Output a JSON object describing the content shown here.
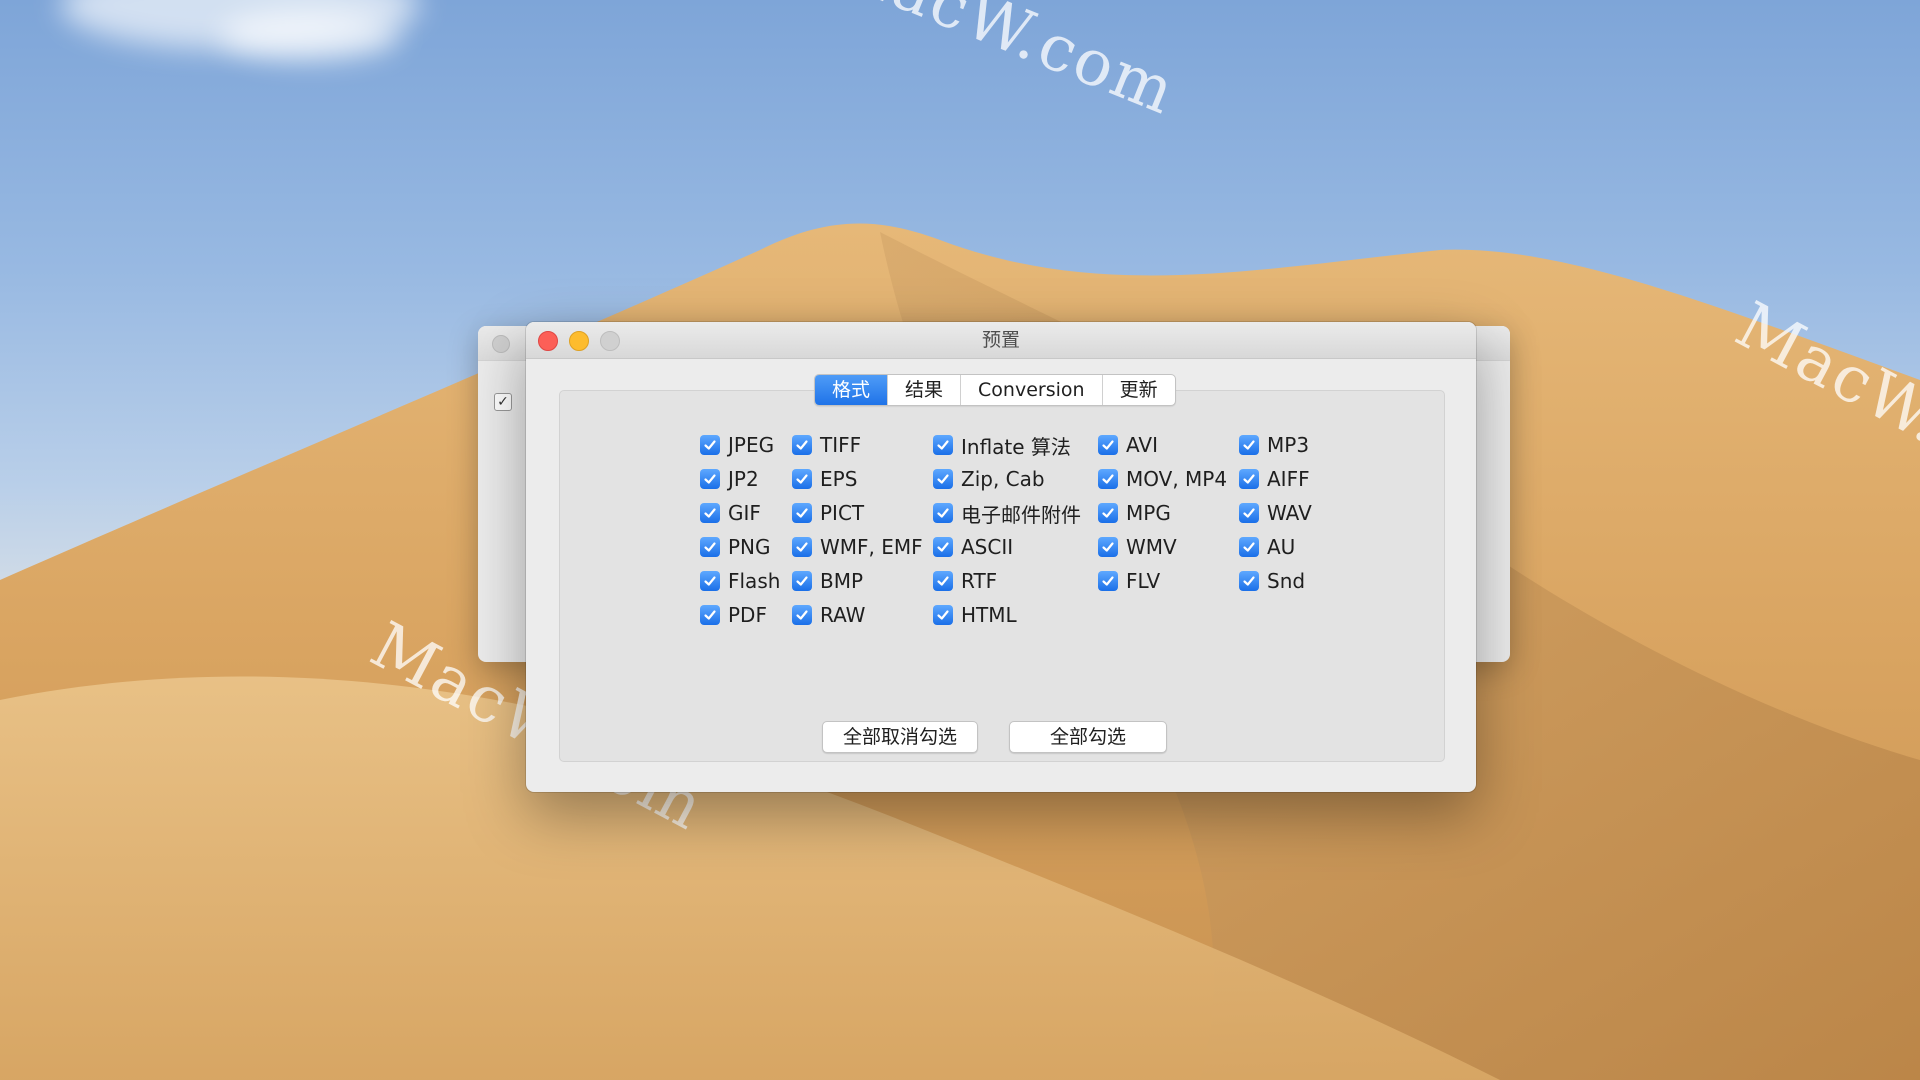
{
  "watermark": "MacW.com",
  "window": {
    "title": "预置"
  },
  "tabs": [
    "格式",
    "结果",
    "Conversion",
    "更新"
  ],
  "active_tab": "格式",
  "columns": [
    [
      "JPEG",
      "JP2",
      "GIF",
      "PNG",
      "Flash",
      "PDF"
    ],
    [
      "TIFF",
      "EPS",
      "PICT",
      "WMF, EMF",
      "BMP",
      "RAW"
    ],
    [
      "Inflate 算法",
      "Zip, Cab",
      "电子邮件附件",
      "ASCII",
      "RTF",
      "HTML"
    ],
    [
      "AVI",
      "MOV, MP4",
      "MPG",
      "WMV",
      "FLV"
    ],
    [
      "MP3",
      "AIFF",
      "WAV",
      "AU",
      "Snd"
    ]
  ],
  "all_checked": true,
  "buttons": {
    "deselect_all": "全部取消勾选",
    "select_all": "全部勾选"
  },
  "colors": {
    "accent": "#1f73e8",
    "close": "#fc5f57",
    "minimize": "#fdbc2e",
    "maximize": "#d0d0d0"
  },
  "icons": {
    "checkbox": "checkmark-icon"
  }
}
